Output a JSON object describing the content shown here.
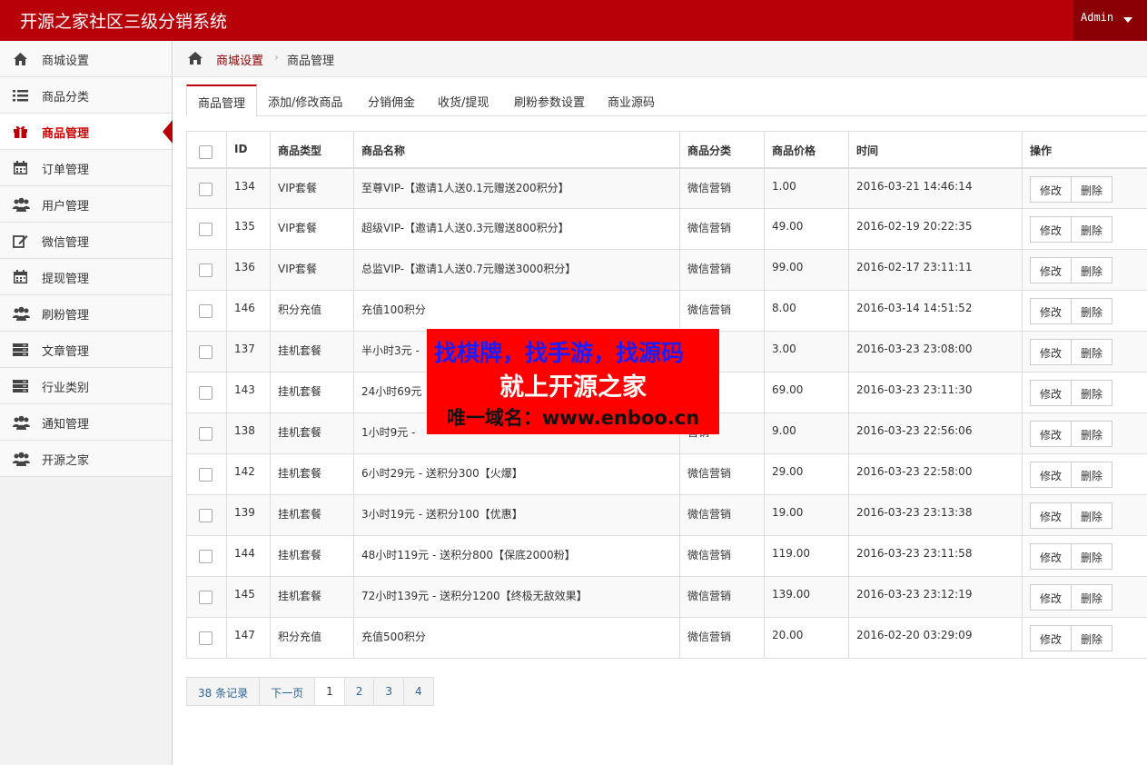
{
  "app": {
    "title": "开源之家社区三级分销系统",
    "user_label": "Admin"
  },
  "colors": {
    "brand": "#b70007",
    "brand_dark": "#8a0005",
    "link": "#2a6496"
  },
  "sidebar": {
    "items": [
      {
        "label": "商城设置",
        "icon": "home-icon"
      },
      {
        "label": "商品分类",
        "icon": "list-icon"
      },
      {
        "label": "商品管理",
        "icon": "gift-icon",
        "active": true
      },
      {
        "label": "订单管理",
        "icon": "calendar-icon"
      },
      {
        "label": "用户管理",
        "icon": "users-icon"
      },
      {
        "label": "微信管理",
        "icon": "edit-icon"
      },
      {
        "label": "提现管理",
        "icon": "calendar-icon"
      },
      {
        "label": "刷粉管理",
        "icon": "users-icon"
      },
      {
        "label": "文章管理",
        "icon": "server-icon"
      },
      {
        "label": "行业类别",
        "icon": "server-icon"
      },
      {
        "label": "通知管理",
        "icon": "users-icon"
      },
      {
        "label": "开源之家",
        "icon": "users-icon"
      }
    ]
  },
  "breadcrumb": {
    "parent": "商城设置",
    "current": "商品管理"
  },
  "tabs": [
    "商品管理",
    "添加/修改商品",
    "分销佣金",
    "收货/提现",
    "刷粉参数设置",
    "商业源码"
  ],
  "table": {
    "headers": [
      "ID",
      "商品类型",
      "商品名称",
      "商品分类",
      "商品价格",
      "时间",
      "操作"
    ],
    "edit_label": "修改",
    "delete_label": "删除",
    "rows": [
      {
        "id": "134",
        "type": "VIP套餐",
        "name": "至尊VIP-【邀请1人送0.1元赠送200积分】",
        "category": "微信营销",
        "price": "1.00",
        "time": "2016-03-21 14:46:14"
      },
      {
        "id": "135",
        "type": "VIP套餐",
        "name": "超级VIP-【邀请1人送0.3元赠送800积分】",
        "category": "微信营销",
        "price": "49.00",
        "time": "2016-02-19 20:22:35"
      },
      {
        "id": "136",
        "type": "VIP套餐",
        "name": "总监VIP-【邀请1人送0.7元赠送3000积分】",
        "category": "微信营销",
        "price": "99.00",
        "time": "2016-02-17 23:11:11"
      },
      {
        "id": "146",
        "type": "积分充值",
        "name": "充值100积分",
        "category": "微信营销",
        "price": "8.00",
        "time": "2016-03-14 14:51:52"
      },
      {
        "id": "137",
        "type": "挂机套餐",
        "name": "半小时3元 -",
        "category": "营销",
        "price": "3.00",
        "time": "2016-03-23 23:08:00"
      },
      {
        "id": "143",
        "type": "挂机套餐",
        "name": "24小时69元",
        "category": "营销",
        "price": "69.00",
        "time": "2016-03-23 23:11:30"
      },
      {
        "id": "138",
        "type": "挂机套餐",
        "name": "1小时9元 -",
        "category": "营销",
        "price": "9.00",
        "time": "2016-03-23 22:56:06"
      },
      {
        "id": "142",
        "type": "挂机套餐",
        "name": "6小时29元 - 送积分300【火爆】",
        "category": "微信营销",
        "price": "29.00",
        "time": "2016-03-23 22:58:00"
      },
      {
        "id": "139",
        "type": "挂机套餐",
        "name": "3小时19元 - 送积分100【优惠】",
        "category": "微信营销",
        "price": "19.00",
        "time": "2016-03-23 23:13:38"
      },
      {
        "id": "144",
        "type": "挂机套餐",
        "name": "48小时119元 - 送积分800【保底2000粉】",
        "category": "微信营销",
        "price": "119.00",
        "time": "2016-03-23 23:11:58"
      },
      {
        "id": "145",
        "type": "挂机套餐",
        "name": "72小时139元 - 送积分1200【终极无敌效果】",
        "category": "微信营销",
        "price": "139.00",
        "time": "2016-03-23 23:12:19"
      },
      {
        "id": "147",
        "type": "积分充值",
        "name": "充值500积分",
        "category": "微信营销",
        "price": "20.00",
        "time": "2016-02-20 03:29:09"
      }
    ]
  },
  "pagination": {
    "total": "38 条记录",
    "next": "下一页",
    "pages": [
      "1",
      "2",
      "3",
      "4"
    ],
    "current": "1"
  },
  "promo": {
    "line1": "找棋牌，找手游，找源码",
    "line2": "就上开源之家",
    "line3": "唯一域名：www.enboo.cn"
  }
}
